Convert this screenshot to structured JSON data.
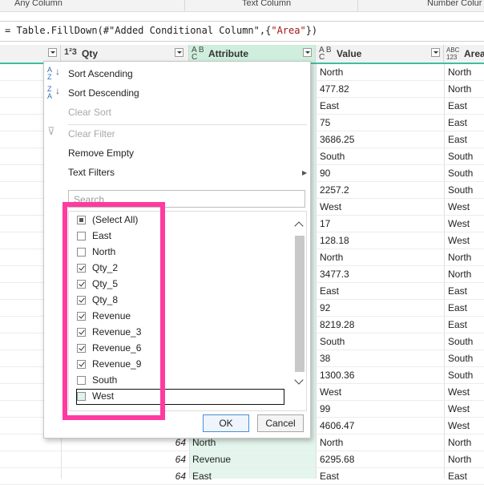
{
  "ribbon": {
    "labels": [
      "Any Column",
      "Text Column",
      "Number Colur"
    ]
  },
  "formula": {
    "prefix": "= Table.FillDown(#\"Added Conditional Column\",{",
    "string": "\"Area\"",
    "suffix": "})"
  },
  "header": {
    "qty": {
      "type": "1²3",
      "name": "Qty"
    },
    "attribute": {
      "type_top": "A B",
      "type_bottom": "C",
      "name": "Attribute"
    },
    "value": {
      "type_top": "A B",
      "type_bottom": "C",
      "name": "Value"
    },
    "area": {
      "type_top": "ABC",
      "type_bottom": "123",
      "name": "Area"
    }
  },
  "rows": [
    {
      "qty": "",
      "attr": "",
      "value": "North",
      "area": "North"
    },
    {
      "qty": "",
      "attr": "",
      "value": "477.82",
      "area": "North"
    },
    {
      "qty": "",
      "attr": "",
      "value": "East",
      "area": "East"
    },
    {
      "qty": "",
      "attr": "",
      "value": "75",
      "area": "East"
    },
    {
      "qty": "",
      "attr": "",
      "value": "3686.25",
      "area": "East"
    },
    {
      "qty": "",
      "attr": "",
      "value": "South",
      "area": "South"
    },
    {
      "qty": "",
      "attr": "",
      "value": "90",
      "area": "South"
    },
    {
      "qty": "",
      "attr": "",
      "value": "2257.2",
      "area": "South"
    },
    {
      "qty": "",
      "attr": "",
      "value": "West",
      "area": "West"
    },
    {
      "qty": "",
      "attr": "",
      "value": "17",
      "area": "West"
    },
    {
      "qty": "",
      "attr": "",
      "value": "128.18",
      "area": "West"
    },
    {
      "qty": "",
      "attr": "",
      "value": "North",
      "area": "North"
    },
    {
      "qty": "",
      "attr": "",
      "value": "3477.3",
      "area": "North"
    },
    {
      "qty": "",
      "attr": "",
      "value": "East",
      "area": "East"
    },
    {
      "qty": "",
      "attr": "",
      "value": "92",
      "area": "East"
    },
    {
      "qty": "",
      "attr": "",
      "value": "8219.28",
      "area": "East"
    },
    {
      "qty": "",
      "attr": "",
      "value": "South",
      "area": "South"
    },
    {
      "qty": "",
      "attr": "",
      "value": "38",
      "area": "South"
    },
    {
      "qty": "",
      "attr": "",
      "value": "1300.36",
      "area": "South"
    },
    {
      "qty": "",
      "attr": "",
      "value": "West",
      "area": "West"
    },
    {
      "qty": "",
      "attr": "",
      "value": "99",
      "area": "West"
    },
    {
      "qty": "",
      "attr": "",
      "value": "4606.47",
      "area": "West"
    },
    {
      "qty": "64",
      "attr": "North",
      "value": "North",
      "area": "North"
    },
    {
      "qty": "64",
      "attr": "Revenue",
      "value": "6295.68",
      "area": "North"
    },
    {
      "qty": "64",
      "attr": "East",
      "value": "East",
      "area": "East"
    }
  ],
  "menu": {
    "sort_ascending": "Sort Ascending",
    "sort_descending": "Sort Descending",
    "clear_sort": "Clear Sort",
    "clear_filter": "Clear Filter",
    "remove_empty": "Remove Empty",
    "text_filters": "Text Filters",
    "search_placeholder": "Search",
    "ok_label": "OK",
    "cancel_label": "Cancel"
  },
  "filter_items": [
    {
      "label": "(Select All)",
      "state": "partial"
    },
    {
      "label": "East",
      "state": "unchecked"
    },
    {
      "label": "North",
      "state": "unchecked"
    },
    {
      "label": "Qty_2",
      "state": "checked"
    },
    {
      "label": "Qty_5",
      "state": "checked"
    },
    {
      "label": "Qty_8",
      "state": "checked"
    },
    {
      "label": "Revenue",
      "state": "checked"
    },
    {
      "label": "Revenue_3",
      "state": "checked"
    },
    {
      "label": "Revenue_6",
      "state": "checked"
    },
    {
      "label": "Revenue_9",
      "state": "checked"
    },
    {
      "label": "South",
      "state": "unchecked"
    },
    {
      "label": "West",
      "state": "hovered"
    }
  ],
  "colors": {
    "accent_teal": "#3cbfa0",
    "attribute_band": "#e3f5ec",
    "highlight_pink": "#ff3aa0"
  }
}
